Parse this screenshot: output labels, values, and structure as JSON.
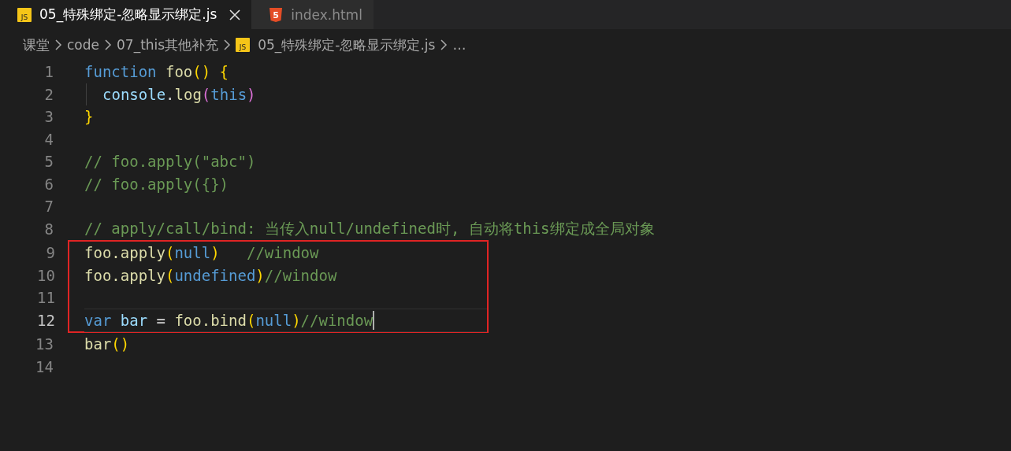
{
  "tabs": [
    {
      "label": "05_特殊绑定-忽略显示绑定.js",
      "selected": true,
      "icon": {
        "kind": "js",
        "text": "JS"
      },
      "closable": true
    },
    {
      "label": "index.html",
      "selected": false,
      "icon": {
        "kind": "html",
        "text": "5"
      },
      "closable": false
    }
  ],
  "breadcrumb": [
    {
      "label": "课堂"
    },
    {
      "label": "code"
    },
    {
      "label": "07_this其他补充"
    },
    {
      "label": "05_特殊绑定-忽略显示绑定.js",
      "icon": {
        "kind": "js",
        "text": "JS"
      }
    },
    {
      "label": "…"
    }
  ],
  "editor": {
    "lines": [
      {
        "number": "1",
        "current": false,
        "boxed": false,
        "guide": false,
        "tokens": [
          {
            "kind": "keyword",
            "text": "function "
          },
          {
            "kind": "func",
            "text": "foo"
          },
          {
            "kind": "brace",
            "text": "() {"
          }
        ]
      },
      {
        "number": "2",
        "current": false,
        "boxed": false,
        "guide": true,
        "tokens": [
          {
            "kind": "var",
            "text": "console"
          },
          {
            "kind": "plain",
            "text": "."
          },
          {
            "kind": "func",
            "text": "log"
          },
          {
            "kind": "brace2",
            "text": "("
          },
          {
            "kind": "keyword",
            "text": "this"
          },
          {
            "kind": "brace2",
            "text": ")"
          }
        ]
      },
      {
        "number": "3",
        "current": false,
        "boxed": false,
        "guide": false,
        "tokens": [
          {
            "kind": "brace",
            "text": "}"
          }
        ]
      },
      {
        "number": "4",
        "current": false,
        "boxed": false,
        "guide": false
      },
      {
        "number": "5",
        "current": false,
        "boxed": false,
        "guide": false,
        "tokens": [
          {
            "kind": "comment",
            "text": "// foo.apply(\"abc\")"
          }
        ]
      },
      {
        "number": "6",
        "current": false,
        "boxed": false,
        "guide": false,
        "tokens": [
          {
            "kind": "comment",
            "text": "// foo.apply({})"
          }
        ]
      },
      {
        "number": "7",
        "current": false,
        "boxed": false,
        "guide": false
      },
      {
        "number": "8",
        "current": false,
        "boxed": false,
        "guide": false,
        "tokens": [
          {
            "kind": "comment",
            "text": "// apply/call/bind: 当传入null/undefined时, 自动将this绑定成全局对象"
          }
        ]
      },
      {
        "number": "9",
        "current": false,
        "boxed": true,
        "guide": false,
        "tokens": [
          {
            "kind": "func",
            "text": "foo.apply"
          },
          {
            "kind": "brace",
            "text": "("
          },
          {
            "kind": "keyword",
            "text": "null"
          },
          {
            "kind": "brace",
            "text": ")"
          },
          {
            "kind": "comment",
            "text": "   //window"
          }
        ]
      },
      {
        "number": "10",
        "current": false,
        "boxed": true,
        "guide": false,
        "tokens": [
          {
            "kind": "func",
            "text": "foo.apply"
          },
          {
            "kind": "brace",
            "text": "("
          },
          {
            "kind": "keyword",
            "text": "undefined"
          },
          {
            "kind": "brace",
            "text": ")"
          },
          {
            "kind": "comment",
            "text": "//window"
          }
        ]
      },
      {
        "number": "11",
        "current": false,
        "boxed": true,
        "guide": false
      },
      {
        "number": "12",
        "current": true,
        "boxed": true,
        "guide": false,
        "tokens": [
          {
            "kind": "keyword",
            "text": "var "
          },
          {
            "kind": "var",
            "text": "bar"
          },
          {
            "kind": "plain",
            "text": " = "
          },
          {
            "kind": "func",
            "text": "foo.bind"
          },
          {
            "kind": "brace",
            "text": "("
          },
          {
            "kind": "keyword",
            "text": "null"
          },
          {
            "kind": "brace",
            "text": ")"
          },
          {
            "kind": "comment",
            "text": "//window"
          }
        ]
      },
      {
        "number": "13",
        "current": false,
        "boxed": false,
        "guide": false,
        "tokens": [
          {
            "kind": "func",
            "text": "bar"
          },
          {
            "kind": "brace",
            "text": "()"
          }
        ]
      },
      {
        "number": "14",
        "current": false,
        "boxed": false,
        "guide": false
      }
    ]
  }
}
